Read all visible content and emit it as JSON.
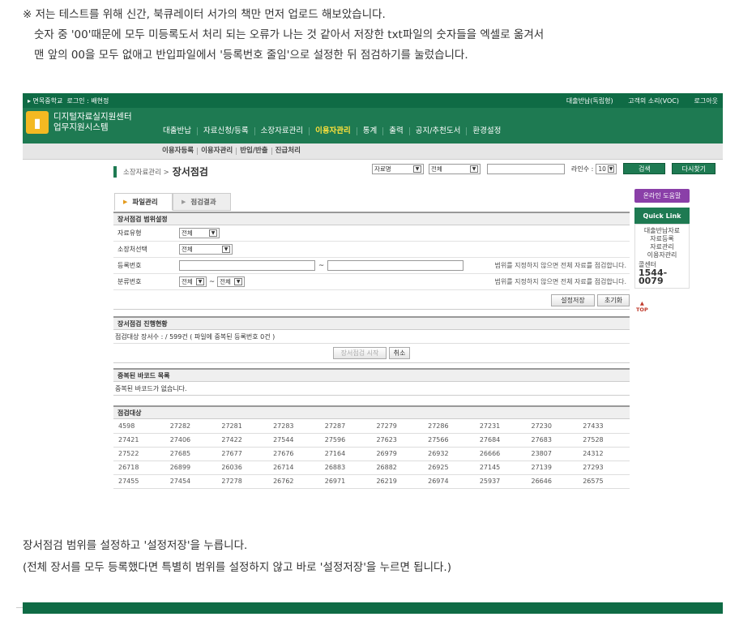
{
  "post": {
    "line1": "※ 저는 테스트를 위해 신간, 북큐레이터 서가의 책만 먼저 업로드 해보았습니다.",
    "line2": "숫자 중 '00'때문에 모두 미등록도서 처리 되는 오류가 나는 것 같아서 저장한 txt파일의 숫자들을 엑셀로 옮겨서",
    "line3": "맨 앞의 00을 모두 없애고 반입파일에서 '등록번호 줄임'으로 설정한 뒤 점검하기를 눌렀습니다.",
    "bottom1": "장서점검 범위를 설정하고 '설정저장'을 누릅니다.",
    "bottom2": "(전체 장서를 모두 등록했다면 특별히 범위를 설정하지 않고 바로 '설정저장'을 누르면 됩니다.)"
  },
  "topbar": {
    "school": "▸ 면목중학교",
    "login": "로그인 : 배현정",
    "links": [
      "대출반납(독립형)",
      "고객의 소리(VOC)",
      "로그아웃"
    ]
  },
  "logo": {
    "line1": "디지털자료실지원센터",
    "line2": "업무지원시스템"
  },
  "mainnav": [
    "대출반납",
    "자료신청/등록",
    "소장자료관리",
    "이용자관리",
    "통계",
    "출력",
    "공지/추천도서",
    "환경설정"
  ],
  "subnav": [
    "이용자등록",
    "이용자관리",
    "반입/반출",
    "진급처리"
  ],
  "title": {
    "crumb": "소장자료관리 >",
    "page": "장서점검"
  },
  "search": {
    "field": "자료명",
    "scope": "전체",
    "lines_label": "라인수 :",
    "lines": "10",
    "search_btn": "검색",
    "research_btn": "다시찾기"
  },
  "tabs": [
    "파일관리",
    "점검결과"
  ],
  "range": {
    "header": "장서점검 범위설정",
    "rows": [
      {
        "label": "자료유형",
        "value": "전체"
      },
      {
        "label": "소장처선택",
        "value": "전체"
      },
      {
        "label": "등록번호",
        "hint": "범위를 지정하지 않으면 전체 자료를 점검합니다."
      },
      {
        "label": "분류번호",
        "value_a": "전체",
        "value_b": "전체",
        "hint": "범위를 지정하지 않으면 전체 자료를 점검합니다."
      }
    ],
    "save_btn": "설정저장",
    "reset_btn": "초기화"
  },
  "progress": {
    "header": "장서점검 진행현황",
    "status": "점검대상 장서수 : / 599건 ( 파일에 중복된 등록번호 0건 )",
    "start_btn": "장서점검 시작",
    "cancel_btn": "취소"
  },
  "dup": {
    "header": "중복된 바코드 목록",
    "message": "중복된 바코드가 없습니다."
  },
  "targets": {
    "header": "점검대상",
    "rows": [
      [
        "4598",
        "27282",
        "27281",
        "27283",
        "27287",
        "27279",
        "27286",
        "27231",
        "27230",
        "27433"
      ],
      [
        "27421",
        "27406",
        "27422",
        "27544",
        "27596",
        "27623",
        "27566",
        "27684",
        "27683",
        "27528"
      ],
      [
        "27522",
        "27685",
        "27677",
        "27676",
        "27164",
        "26979",
        "26932",
        "26666",
        "23807",
        "24312"
      ],
      [
        "26718",
        "26899",
        "26036",
        "26714",
        "26883",
        "26882",
        "26925",
        "27145",
        "27139",
        "27293"
      ],
      [
        "27455",
        "27454",
        "27278",
        "26762",
        "26971",
        "26219",
        "26974",
        "25937",
        "26646",
        "26575"
      ]
    ]
  },
  "side": {
    "online_help": "온라인 도움말",
    "quick": "Quick Link",
    "links": [
      "대출반납자료",
      "자료등록",
      "자료관리",
      "이용자관리"
    ],
    "call_label": "콜센터",
    "call_number": "1544-0079",
    "top": "TOP"
  }
}
